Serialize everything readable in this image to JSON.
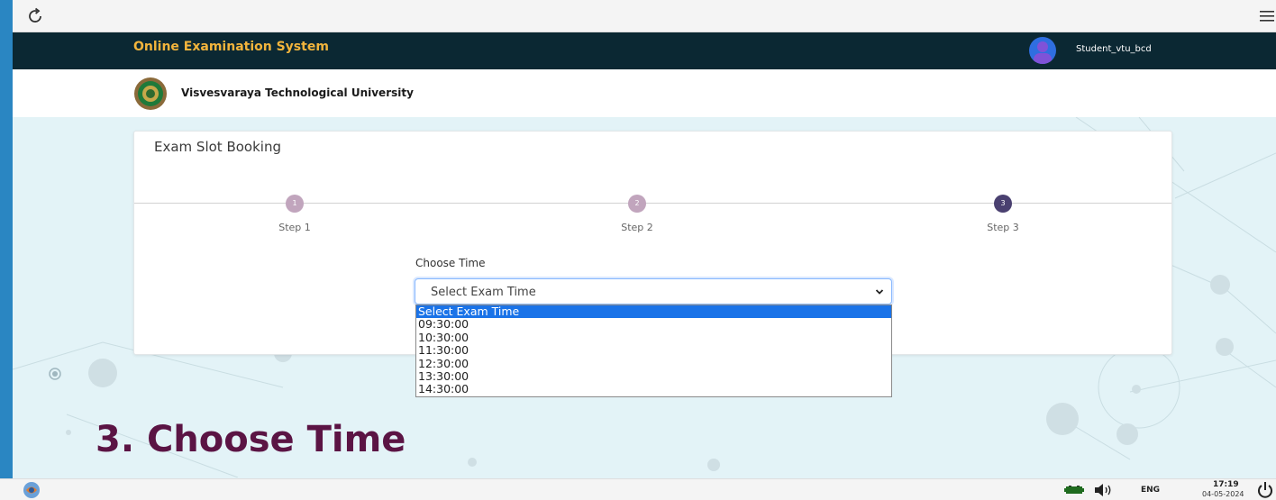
{
  "browser": {
    "reload_icon": "reload-icon",
    "menu_icon": "hamburger-menu-icon"
  },
  "header": {
    "title": "Online Examination System",
    "username": "Student_vtu_bcd",
    "avatar_color": "#2f6ee0",
    "background": "#0b2833",
    "title_color": "#f2b43c"
  },
  "university": {
    "name": "Visvesvaraya Technological University"
  },
  "card": {
    "title": "Exam Slot Booking",
    "steps": [
      {
        "number": "1",
        "label": "Step 1",
        "state": "done"
      },
      {
        "number": "2",
        "label": "Step 2",
        "state": "done"
      },
      {
        "number": "3",
        "label": "Step 3",
        "state": "active"
      }
    ],
    "field_label": "Choose Time",
    "select": {
      "value": "Select Exam Time",
      "options": [
        "Select Exam Time",
        "09:30:00",
        "10:30:00",
        "11:30:00",
        "12:30:00",
        "13:30:00",
        "14:30:00"
      ],
      "selected_index": 0
    }
  },
  "caption": "3. Choose Time",
  "taskbar": {
    "lang": "ENG",
    "time": "17:19",
    "date": "04-05-2024"
  }
}
